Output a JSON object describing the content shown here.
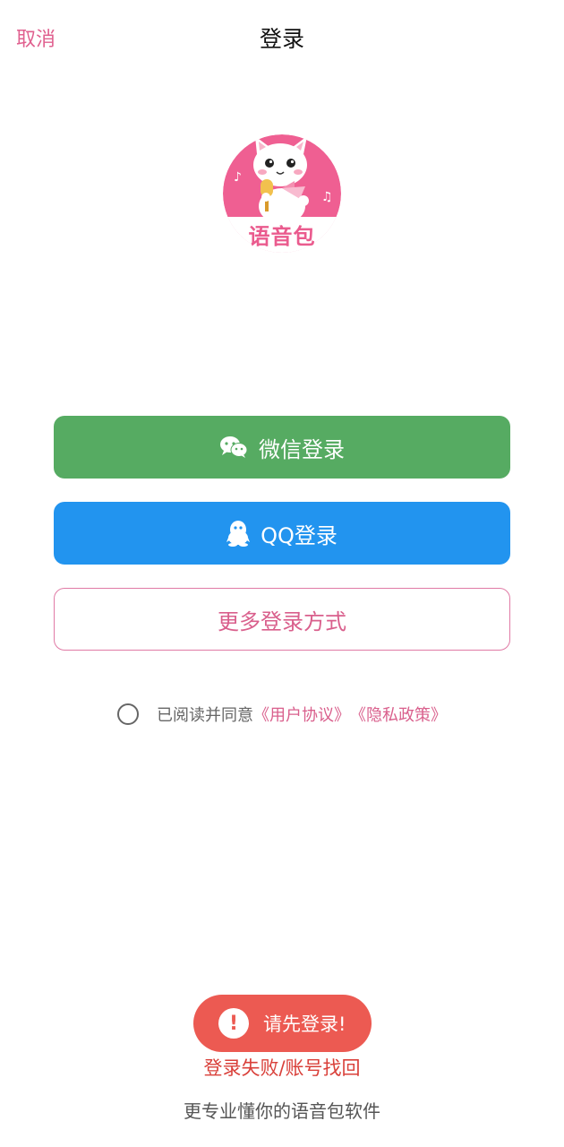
{
  "header": {
    "cancel_label": "取消",
    "title": "登录"
  },
  "logo": {
    "text": "语音包",
    "icon": "cat-microphone-logo"
  },
  "buttons": {
    "wechat_label": "微信登录",
    "wechat_icon": "wechat-icon",
    "qq_label": "QQ登录",
    "qq_icon": "qq-penguin-icon",
    "more_label": "更多登录方式"
  },
  "agreement": {
    "prefix": "已阅读并同意",
    "user_agreement": "《用户协议》",
    "privacy_policy": "《隐私政策》",
    "checked": false
  },
  "toast": {
    "message": "请先登录!",
    "icon": "exclamation-icon"
  },
  "recover_link": "登录失败/账号找回",
  "footer_slogan": "更专业懂你的语音包软件",
  "colors": {
    "accent": "#d95f8c",
    "wechat": "#56ab62",
    "qq": "#2294ef",
    "toast": "#ec5a52",
    "recover": "#d9403a"
  }
}
